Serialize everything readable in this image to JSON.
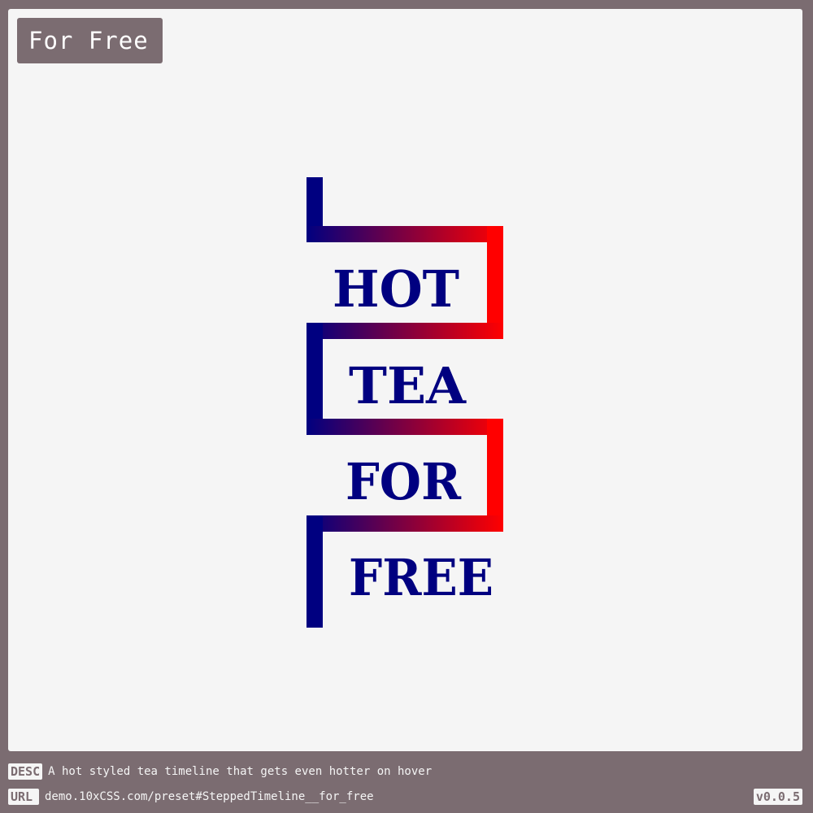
{
  "header": {
    "title": "For Free"
  },
  "timeline": {
    "steps": [
      "HOT",
      "TEA",
      "FOR",
      "FREE"
    ],
    "colors": {
      "text": "#000080",
      "gradient_start": "#000080",
      "gradient_end": "#ff0000"
    }
  },
  "footer": {
    "desc_tag": "DESC",
    "desc_text": "A hot styled tea timeline that gets even hotter on hover",
    "url_tag": "URL",
    "url_text": "demo.10xCSS.com/preset#SteppedTimeline__for_free",
    "version": "v0.0.5"
  },
  "colors": {
    "outer_background": "#7b6c71",
    "canvas_background": "#f5f5f5"
  }
}
